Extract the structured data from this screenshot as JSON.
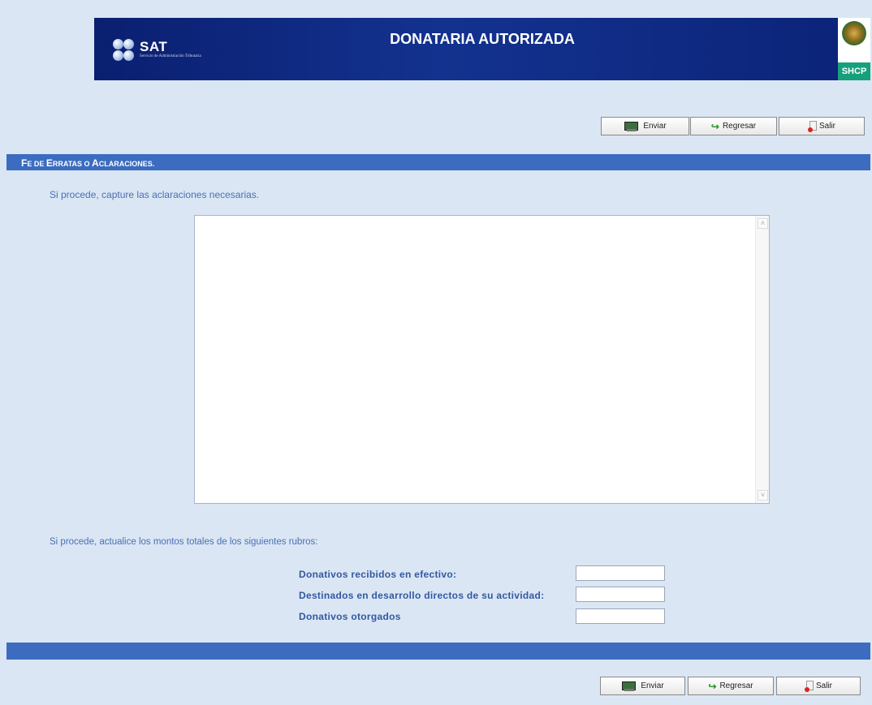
{
  "header": {
    "logo_text": "SAT",
    "logo_subtext": "Servicio de Administración Tributaria",
    "title": "DONATARIA AUTORIZADA",
    "badge": "SHCP"
  },
  "toolbar": {
    "send_label": "Enviar",
    "back_label": "Regresar",
    "exit_label": "Salir"
  },
  "section": {
    "title": "Fe de Erratas o Aclaraciones.",
    "instructions": "Si procede, capture las aclaraciones necesarias.",
    "clarifications_value": ""
  },
  "totals": {
    "instructions": "Si procede, actualice los montos totales de los siguientes rubros:",
    "fields": [
      {
        "label": "Donativos recibidos en efectivo:",
        "value": ""
      },
      {
        "label": "Destinados en desarrollo directos de su actividad:",
        "value": ""
      },
      {
        "label": "Donativos otorgados",
        "value": ""
      }
    ]
  },
  "colors": {
    "background": "#dae6f3",
    "header": "#13328f",
    "bar": "#3b6cbf",
    "label": "#3358a3",
    "shcp": "#16a07c"
  },
  "icons": [
    "send-icon",
    "back-arrow-icon",
    "exit-icon",
    "scroll-up-icon",
    "scroll-down-icon",
    "sat-logo",
    "shcp-emblem"
  ]
}
